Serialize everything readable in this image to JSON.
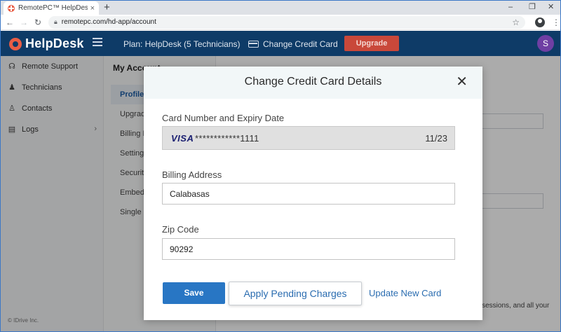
{
  "browser": {
    "tab_title": "RemotePC™ HelpDesk - my accou",
    "tab_close": "×",
    "new_tab": "+",
    "url": "remotepc.com/hd-app/account",
    "win_min": "–",
    "win_max": "❐",
    "win_close": "✕"
  },
  "header": {
    "logo_text": "HelpDesk",
    "plan_text": "Plan: HelpDesk (5 Technicians)",
    "change_card": "Change Credit Card",
    "upgrade": "Upgrade",
    "avatar_initial": "S"
  },
  "sidebar": {
    "items": [
      {
        "label": "Remote Support",
        "icon": "headset-icon"
      },
      {
        "label": "Technicians",
        "icon": "users-icon"
      },
      {
        "label": "Contacts",
        "icon": "user-icon"
      },
      {
        "label": "Logs",
        "icon": "document-icon"
      }
    ],
    "footer": "© IDrive Inc."
  },
  "account": {
    "title": "My Account",
    "items": [
      "Profile",
      "Upgrade",
      "Billing In",
      "Settings",
      "Security",
      "Embed",
      "Single S"
    ],
    "bottom_text": "r sessions, and all your"
  },
  "modal": {
    "title": "Change Credit Card Details",
    "close": "✕",
    "card_label": "Card Number and Expiry Date",
    "card_brand": "VISA",
    "card_number": "************1111",
    "card_expiry": "11/23",
    "billing_label": "Billing Address",
    "billing_value": "Calabasas",
    "zip_label": "Zip Code",
    "zip_value": "90292",
    "save": "Save",
    "apply": "Apply Pending Charges",
    "update": "Update New Card"
  },
  "colors": {
    "header_bg": "#0e3b67",
    "upgrade_bg": "#c9483a",
    "primary": "#2876c4",
    "avatar": "#6f3fa3"
  }
}
